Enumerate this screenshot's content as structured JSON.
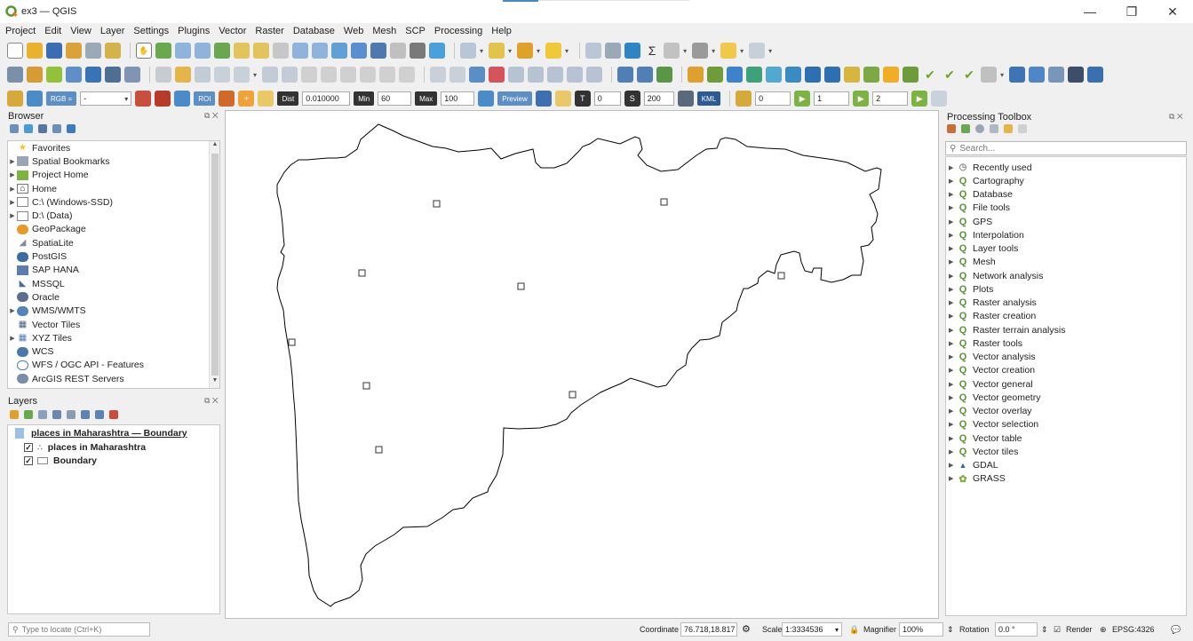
{
  "window": {
    "title": "ex3 — QGIS",
    "minimize": "—",
    "maximize": "❐",
    "close": "✕"
  },
  "menu": [
    "Project",
    "Edit",
    "View",
    "Layer",
    "Settings",
    "Plugins",
    "Vector",
    "Raster",
    "Database",
    "Web",
    "Mesh",
    "SCP",
    "Processing",
    "Help"
  ],
  "scp_toolbar": {
    "rgb_label": "RGB =",
    "rgb_value": "-",
    "roi_label": "ROI",
    "dist_label": "Dist",
    "dist_value": "0.010000",
    "min_label": "Min",
    "min_value": "60",
    "max_label": "Max",
    "max_value": "100",
    "preview_label": "Preview",
    "t_value": "0",
    "s_value": "200",
    "kml_label": "KML",
    "band_value": "0",
    "start_value": "1",
    "end_value": "2"
  },
  "browser": {
    "title": "Browser",
    "items": [
      {
        "label": "Favorites",
        "icon": "star-icon",
        "expandable": false
      },
      {
        "label": "Spatial Bookmarks",
        "icon": "bookmark-icon",
        "expandable": true
      },
      {
        "label": "Project Home",
        "icon": "project-home-icon",
        "expandable": true
      },
      {
        "label": "Home",
        "icon": "home-icon",
        "expandable": true
      },
      {
        "label": "C:\\ (Windows-SSD)",
        "icon": "drive-icon",
        "expandable": true
      },
      {
        "label": "D:\\ (Data)",
        "icon": "drive-icon",
        "expandable": true
      },
      {
        "label": "GeoPackage",
        "icon": "geopackage-icon",
        "expandable": false
      },
      {
        "label": "SpatiaLite",
        "icon": "spatialite-icon",
        "expandable": false
      },
      {
        "label": "PostGIS",
        "icon": "postgis-icon",
        "expandable": false
      },
      {
        "label": "SAP HANA",
        "icon": "saphana-icon",
        "expandable": false
      },
      {
        "label": "MSSQL",
        "icon": "mssql-icon",
        "expandable": false
      },
      {
        "label": "Oracle",
        "icon": "oracle-icon",
        "expandable": false
      },
      {
        "label": "WMS/WMTS",
        "icon": "wms-icon",
        "expandable": true
      },
      {
        "label": "Vector Tiles",
        "icon": "vector-tiles-icon",
        "expandable": false
      },
      {
        "label": "XYZ Tiles",
        "icon": "xyz-tiles-icon",
        "expandable": true
      },
      {
        "label": "WCS",
        "icon": "wcs-icon",
        "expandable": false
      },
      {
        "label": "WFS / OGC API - Features",
        "icon": "wfs-icon",
        "expandable": false
      },
      {
        "label": "ArcGIS REST Servers",
        "icon": "arcgis-icon",
        "expandable": false
      }
    ]
  },
  "layers": {
    "title": "Layers",
    "group": "places in Maharashtra — Boundary",
    "items": [
      {
        "label": "places in Maharashtra",
        "checked": true,
        "icon": "point-layer-icon"
      },
      {
        "label": "Boundary",
        "checked": true,
        "icon": "polygon-layer-icon"
      }
    ]
  },
  "map": {
    "boundary_color": "#000000",
    "point_count": 10
  },
  "processing": {
    "title": "Processing Toolbox",
    "search_placeholder": "Search...",
    "items": [
      {
        "label": "Recently used",
        "icon": "clock-icon"
      },
      {
        "label": "Cartography",
        "icon": "qgis-icon"
      },
      {
        "label": "Database",
        "icon": "qgis-icon"
      },
      {
        "label": "File tools",
        "icon": "qgis-icon"
      },
      {
        "label": "GPS",
        "icon": "qgis-icon"
      },
      {
        "label": "Interpolation",
        "icon": "qgis-icon"
      },
      {
        "label": "Layer tools",
        "icon": "qgis-icon"
      },
      {
        "label": "Mesh",
        "icon": "qgis-icon"
      },
      {
        "label": "Network analysis",
        "icon": "qgis-icon"
      },
      {
        "label": "Plots",
        "icon": "qgis-icon"
      },
      {
        "label": "Raster analysis",
        "icon": "qgis-icon"
      },
      {
        "label": "Raster creation",
        "icon": "qgis-icon"
      },
      {
        "label": "Raster terrain analysis",
        "icon": "qgis-icon"
      },
      {
        "label": "Raster tools",
        "icon": "qgis-icon"
      },
      {
        "label": "Vector analysis",
        "icon": "qgis-icon"
      },
      {
        "label": "Vector creation",
        "icon": "qgis-icon"
      },
      {
        "label": "Vector general",
        "icon": "qgis-icon"
      },
      {
        "label": "Vector geometry",
        "icon": "qgis-icon"
      },
      {
        "label": "Vector overlay",
        "icon": "qgis-icon"
      },
      {
        "label": "Vector selection",
        "icon": "qgis-icon"
      },
      {
        "label": "Vector table",
        "icon": "qgis-icon"
      },
      {
        "label": "Vector tiles",
        "icon": "qgis-icon"
      },
      {
        "label": "GDAL",
        "icon": "gdal-icon"
      },
      {
        "label": "GRASS",
        "icon": "grass-icon"
      }
    ]
  },
  "status": {
    "locate_placeholder": "Type to locate (Ctrl+K)",
    "coordinate_label": "Coordinate",
    "coordinate_value": "76.718,18.817",
    "scale_label": "Scale",
    "scale_value": "1:3334536",
    "magnifier_label": "Magnifier",
    "magnifier_value": "100%",
    "rotation_label": "Rotation",
    "rotation_value": "0.0 °",
    "render_label": "Render",
    "crs": "EPSG:4326"
  }
}
